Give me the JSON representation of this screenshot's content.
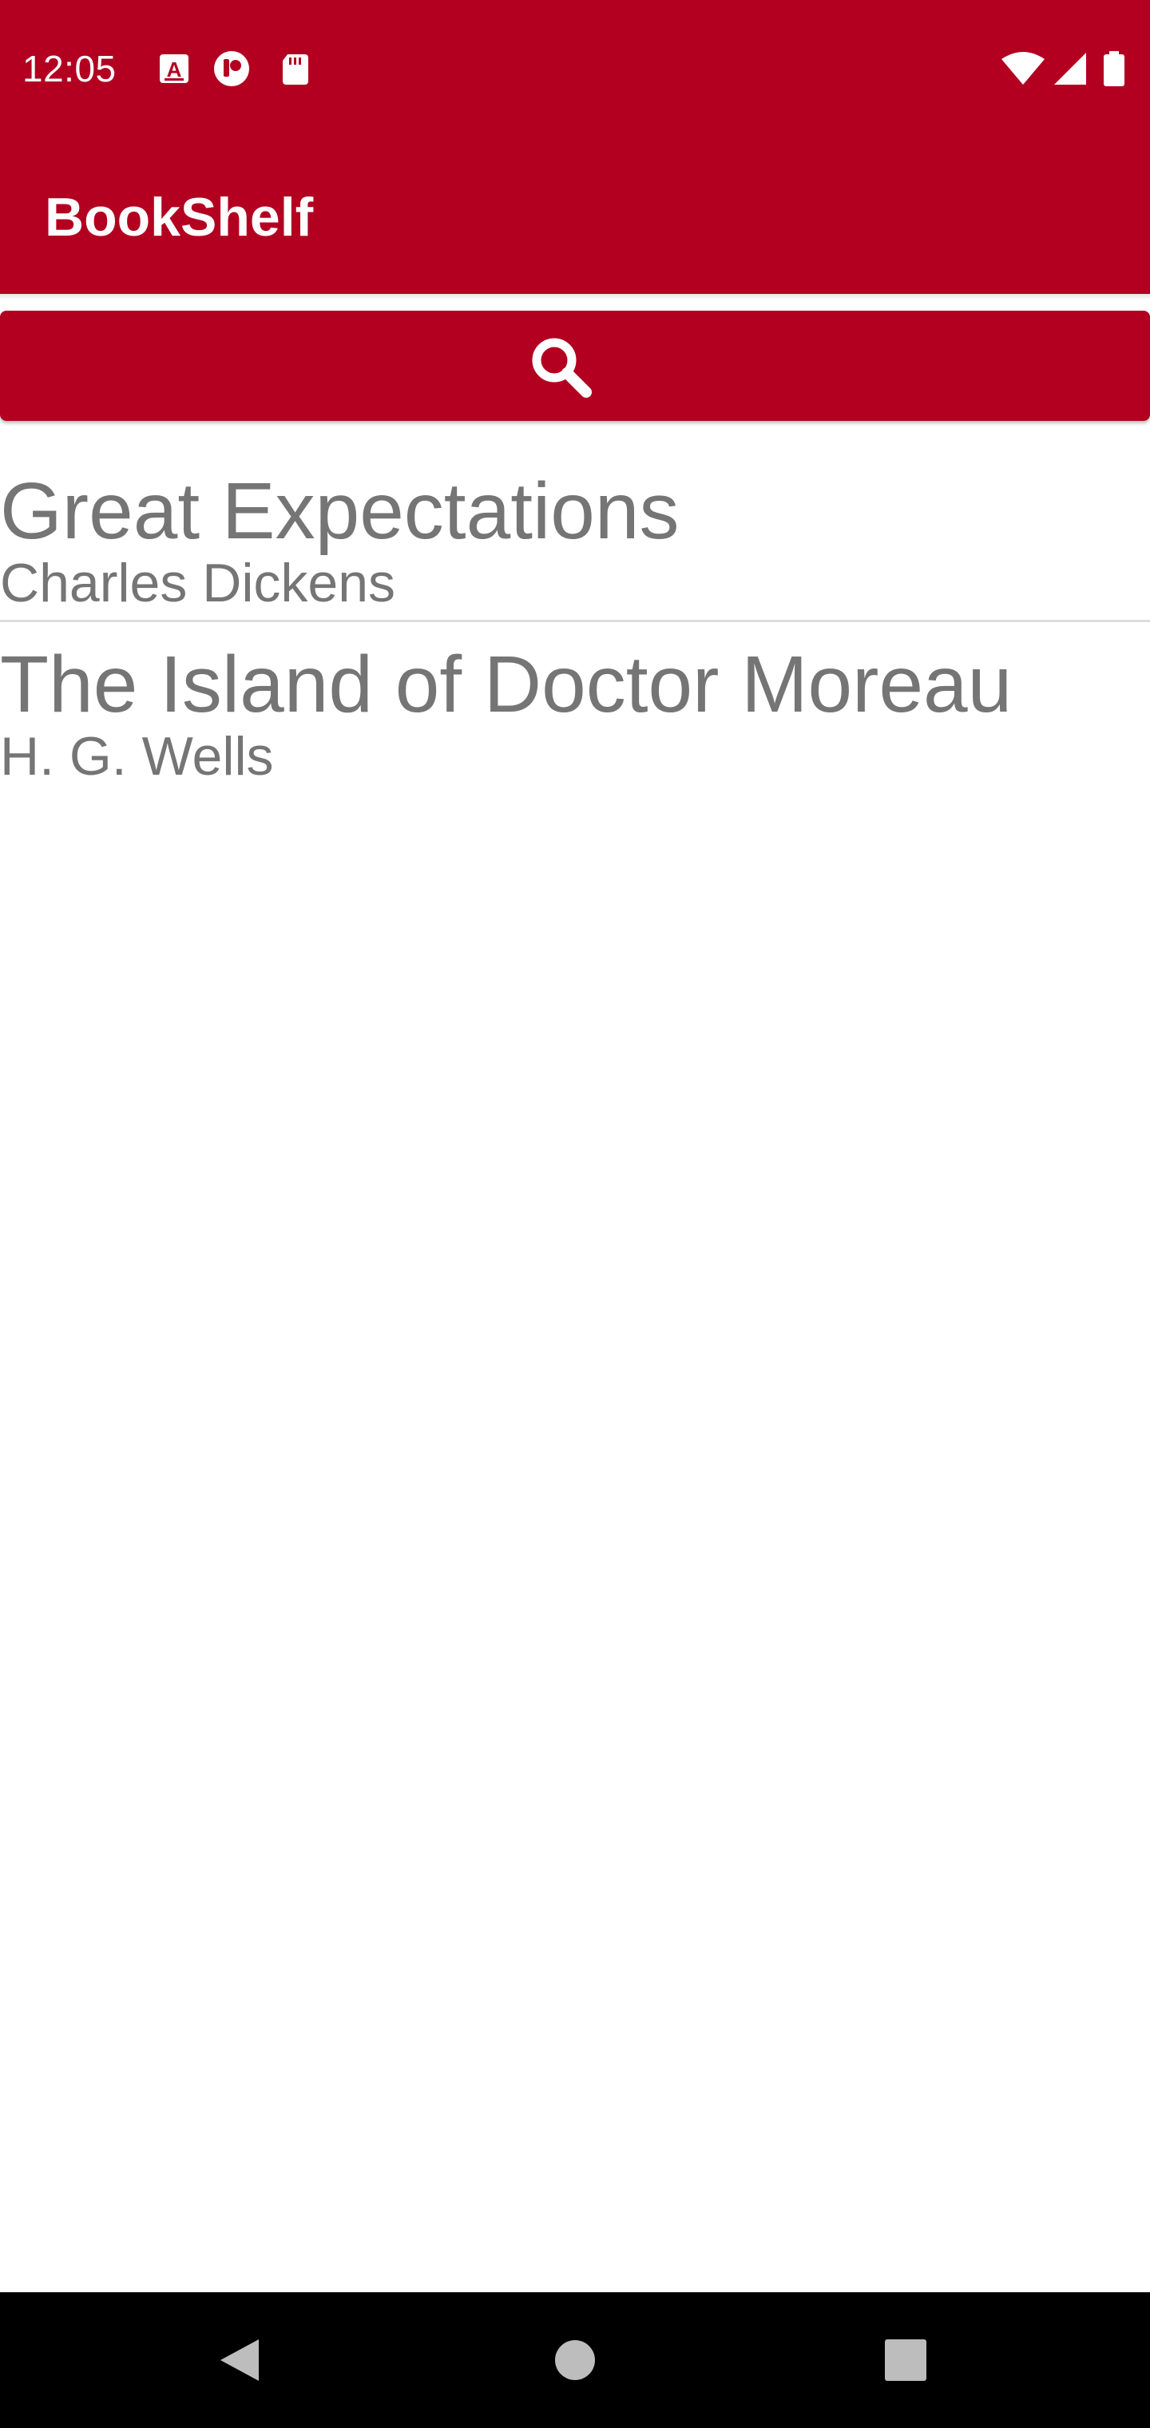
{
  "status_bar": {
    "time": "12:05",
    "left_icons": [
      "a-notification-icon",
      "pocket-casts-icon",
      "sd-card-icon"
    ],
    "right_icons": [
      "wifi-icon",
      "cell-signal-icon",
      "battery-icon"
    ]
  },
  "toolbar": {
    "title": "BookShelf"
  },
  "search": {
    "icon": "search-icon"
  },
  "books": [
    {
      "title": "Great Expectations",
      "author": "Charles Dickens"
    },
    {
      "title": "The Island of Doctor Moreau",
      "author": "H. G. Wells"
    }
  ],
  "nav_bar": {
    "buttons": [
      "back-icon",
      "home-icon",
      "recents-icon"
    ]
  },
  "colors": {
    "primary": "#b30021",
    "text_secondary": "#757575",
    "nav_background": "#000000"
  }
}
